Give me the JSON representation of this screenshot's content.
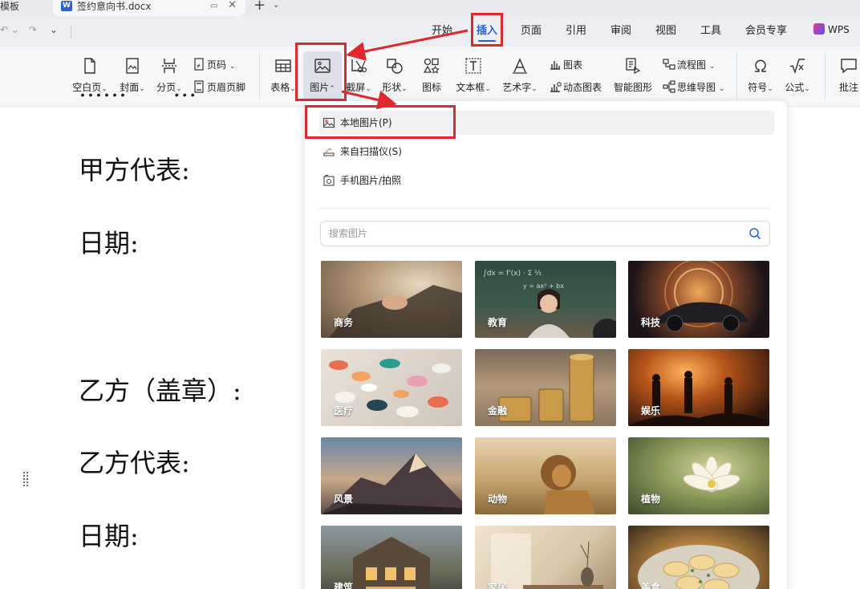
{
  "tabs": {
    "left_partial": "模板",
    "doc_title": "签约意向书.docx",
    "word_logo": "W"
  },
  "menu": {
    "items": [
      "开始",
      "插入",
      "页面",
      "引用",
      "审阅",
      "视图",
      "工具",
      "会员专享"
    ],
    "active": "插入",
    "wps_label": "WPS"
  },
  "ribbon": {
    "blank_page": "空白页",
    "cover": "封面",
    "page_break": "分页",
    "page_number": "页码",
    "header_footer": "页眉页脚",
    "table": "表格",
    "picture": "图片",
    "screenshot": "截屏",
    "shape": "形状",
    "icon": "图标",
    "textbox": "文本框",
    "wordart": "艺术字",
    "chart": "图表",
    "dynamic_chart": "动态图表",
    "smart_graphic": "智能图形",
    "flowchart": "流程图",
    "mindmap": "思维导图",
    "symbol": "符号",
    "formula": "公式",
    "comment": "批注"
  },
  "document": {
    "lines": [
      "甲方代表:",
      "日期:",
      "乙方（盖章）:",
      "乙方代表:",
      "日期:"
    ]
  },
  "dropdown": {
    "options": [
      "本地图片(P)",
      "来自扫描仪(S)",
      "手机图片/拍照"
    ],
    "search_placeholder": "搜索图片",
    "categories": [
      "商务",
      "教育",
      "科技",
      "医疗",
      "金融",
      "娱乐",
      "风景",
      "动物",
      "植物",
      "建筑",
      "家居",
      "美食"
    ]
  },
  "colors": {
    "accent": "#2a62d8",
    "highlight": "#e0282e"
  }
}
